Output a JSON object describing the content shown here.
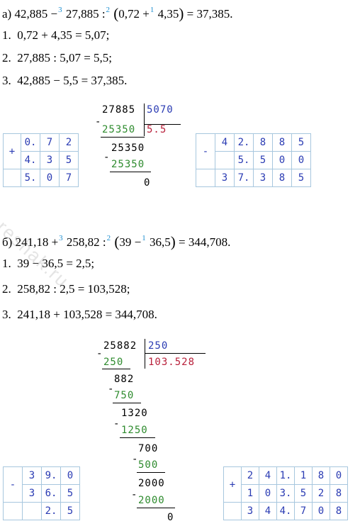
{
  "problem_a": {
    "prefix": "а)",
    "a1": "42,885",
    "op1": "−",
    "ord1": "3",
    "a2": "27,885",
    "op2": ":",
    "ord2": "2",
    "paren_open": "(",
    "a3": "0,72",
    "op3": "+",
    "ord3": "1",
    "a4": "4,35",
    "paren_close": ")",
    "eq": "=",
    "result": "37,385.",
    "steps": [
      {
        "num": "1.",
        "text": "0,72 + 4,35 = 5,07;"
      },
      {
        "num": "2.",
        "text": "27,885 : 5,07 = 5,5;"
      },
      {
        "num": "3.",
        "text": "42,885 − 5,5 = 37,385."
      }
    ],
    "longdiv": {
      "dividend": "27885",
      "divisor": "5070",
      "sub1": "25350",
      "quotient": "5.5",
      "rem1": "25350",
      "sub2": "25350",
      "final": "0",
      "minus": "-"
    },
    "add_table": {
      "op": "+",
      "row1": [
        "0.",
        "7",
        "2"
      ],
      "row2": [
        "4.",
        "3",
        "5"
      ],
      "row3": [
        "5.",
        "0",
        "7"
      ]
    },
    "sub_table": {
      "op": "-",
      "row1": [
        "4",
        "2.",
        "8",
        "8",
        "5"
      ],
      "row2": [
        "",
        "5.",
        "5",
        "0",
        "0"
      ],
      "row3": [
        "3",
        "7.",
        "3",
        "8",
        "5"
      ]
    }
  },
  "problem_b": {
    "prefix": "б)",
    "a1": "241,18",
    "op1": "+",
    "ord1": "3",
    "a2": "258,82",
    "op2": ":",
    "ord2": "2",
    "paren_open": "(",
    "a3": "39",
    "op3": "−",
    "ord3": "1",
    "a4": "36,5",
    "paren_close": ")",
    "eq": "=",
    "result": "344,708.",
    "steps": [
      {
        "num": "1.",
        "text": "39 − 36,5 = 2,5;"
      },
      {
        "num": "2.",
        "text": "258,82 : 2,5 = 103,528;"
      },
      {
        "num": "3.",
        "text": "241,18 + 103,528 = 344,708."
      }
    ],
    "longdiv": {
      "dividend": "25882",
      "divisor": "250",
      "quotient": "103.528",
      "minus": "-",
      "s1": "250",
      "r1": "882",
      "s2": "750",
      "r2": "1320",
      "s3": "1250",
      "r3": "700",
      "s4": "500",
      "r4": "2000",
      "s5": "2000",
      "final": "0"
    },
    "sub_table": {
      "op": "-",
      "row1": [
        "3",
        "9.",
        "0"
      ],
      "row2": [
        "3",
        "6.",
        "5"
      ],
      "row3": [
        "",
        "2.",
        "5"
      ]
    },
    "add_table": {
      "op": "+",
      "row1": [
        "2",
        "4",
        "1.",
        "1",
        "8",
        "0"
      ],
      "row2": [
        "1",
        "0",
        "3.",
        "5",
        "2",
        "8"
      ],
      "row3": [
        "3",
        "4",
        "4.",
        "7",
        "0",
        "8"
      ]
    }
  },
  "watermark": "reshak.ru"
}
